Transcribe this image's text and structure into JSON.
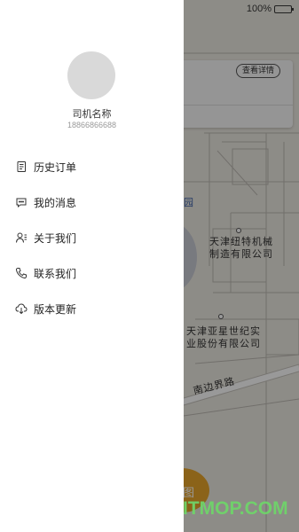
{
  "status_bar": {
    "battery_text": "100%"
  },
  "drawer": {
    "driver_name": "司机名称",
    "driver_phone": "18866866688",
    "menu": [
      {
        "label": "历史订单",
        "icon": "document-icon"
      },
      {
        "label": "我的消息",
        "icon": "chat-bubble-icon"
      },
      {
        "label": "关于我们",
        "icon": "person-info-icon"
      },
      {
        "label": "联系我们",
        "icon": "phone-icon"
      },
      {
        "label": "版本更新",
        "icon": "cloud-download-icon"
      }
    ]
  },
  "map": {
    "details_button": "查看详情",
    "industry_label": "业园",
    "poi_1_line1": "天津纽特机械",
    "poi_1_line2": "制造有限公司",
    "poi_2_line1": "天津亚星世纪实",
    "poi_2_line2": "业股份有限公司",
    "road_name": "南边界路",
    "fab_text": "图"
  },
  "watermark": "ITMOP.COM",
  "colors": {
    "drawer_bg": "#ffffff",
    "map_bg": "#ece9e2",
    "fab": "#e8a52a",
    "watermark": "#6fd46a",
    "avatar": "#d9d9d9"
  }
}
